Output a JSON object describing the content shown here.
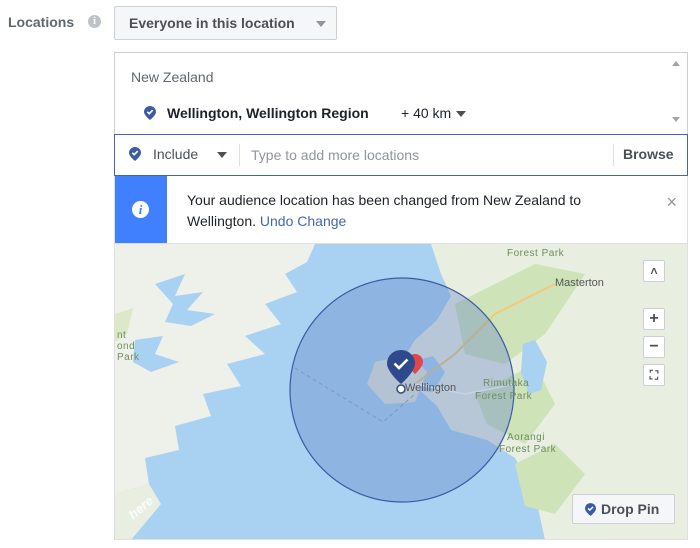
{
  "locations": {
    "label": "Locations",
    "info_icon": "info-icon",
    "type_dropdown": "Everyone in this location"
  },
  "selected": {
    "country": "New Zealand",
    "city": "Wellington, Wellington Region",
    "radius": "+ 40 km"
  },
  "search": {
    "include_label": "Include",
    "placeholder": "Type to add more locations",
    "browse_label": "Browse"
  },
  "notice": {
    "icon": "info-icon",
    "text": "Your audience location has been changed from New Zealand to Wellington.",
    "undo_label": "Undo Change",
    "close_label": "×"
  },
  "map": {
    "places": {
      "masterton": "Masterton",
      "wellington": "Wellington",
      "rimutaka": "Rimutaka Forest Park",
      "rimutaka_1": "Rimutaka",
      "rimutaka_2": "Forest Park",
      "aorangi_1": "Aorangi",
      "aorangi_2": "Forest Park",
      "tararua": "Forest Park",
      "left_1": "nt",
      "left_2": "ond",
      "left_3": "Park"
    },
    "controls": {
      "collapse": "˄",
      "zoom_in": "+",
      "zoom_out": "−",
      "fit": "⛶"
    },
    "drop_pin_label": "Drop Pin",
    "logo_text": "here"
  },
  "colors": {
    "accent": "#4267b2",
    "notice_bar": "#4080ff",
    "pin": "#3b5ba5",
    "water": "#a9d1f2",
    "land": "#e9efe0",
    "radius_fill": "#5b7fc7"
  }
}
